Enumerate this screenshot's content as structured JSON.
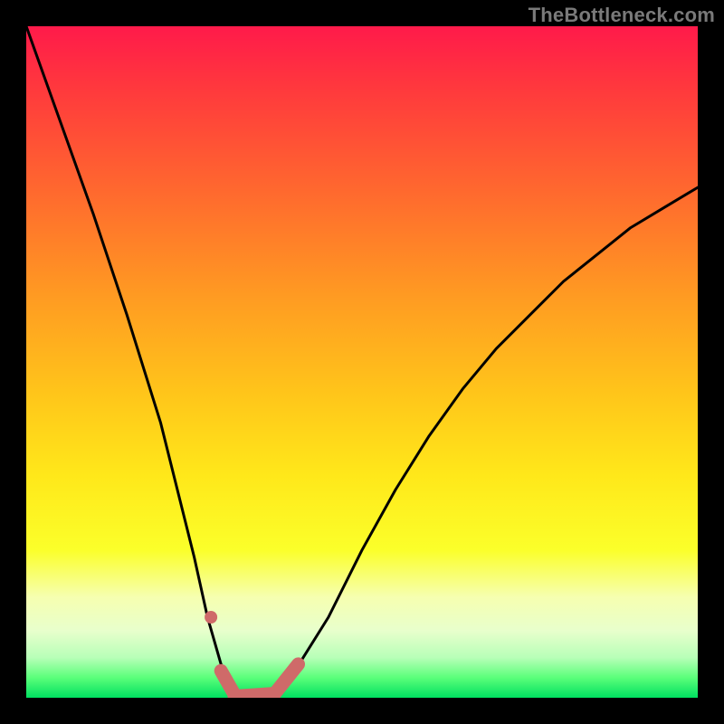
{
  "watermark": {
    "text": "TheBottleneck.com"
  },
  "chart_data": {
    "type": "line",
    "title": "",
    "xlabel": "",
    "ylabel": "",
    "xlim": [
      0,
      100
    ],
    "ylim": [
      0,
      100
    ],
    "series": [
      {
        "name": "bottleneck-curve",
        "x": [
          0,
          5,
          10,
          15,
          20,
          25,
          27,
          29,
          31,
          33,
          35,
          37,
          40,
          45,
          50,
          55,
          60,
          65,
          70,
          75,
          80,
          85,
          90,
          95,
          100
        ],
        "values": [
          100,
          86,
          72,
          57,
          41,
          21,
          12,
          5,
          1,
          0,
          0,
          1,
          4,
          12,
          22,
          31,
          39,
          46,
          52,
          57,
          62,
          66,
          70,
          73,
          76
        ]
      }
    ],
    "annotations": [
      {
        "name": "marker-dot",
        "x": 27.5,
        "y": 12
      },
      {
        "name": "marker-segment-left",
        "x_range": [
          29,
          31
        ],
        "y_range": [
          4,
          0.5
        ]
      },
      {
        "name": "marker-segment-bottom",
        "x_range": [
          31,
          37
        ],
        "y_range": [
          0.2,
          0.6
        ]
      },
      {
        "name": "marker-segment-right",
        "x_range": [
          37,
          40.5
        ],
        "y_range": [
          0.6,
          5
        ]
      }
    ],
    "colors": {
      "curve": "#000000",
      "highlight": "#cf6a69",
      "gradient_top": "#ff1a4a",
      "gradient_bottom": "#00e060"
    }
  }
}
